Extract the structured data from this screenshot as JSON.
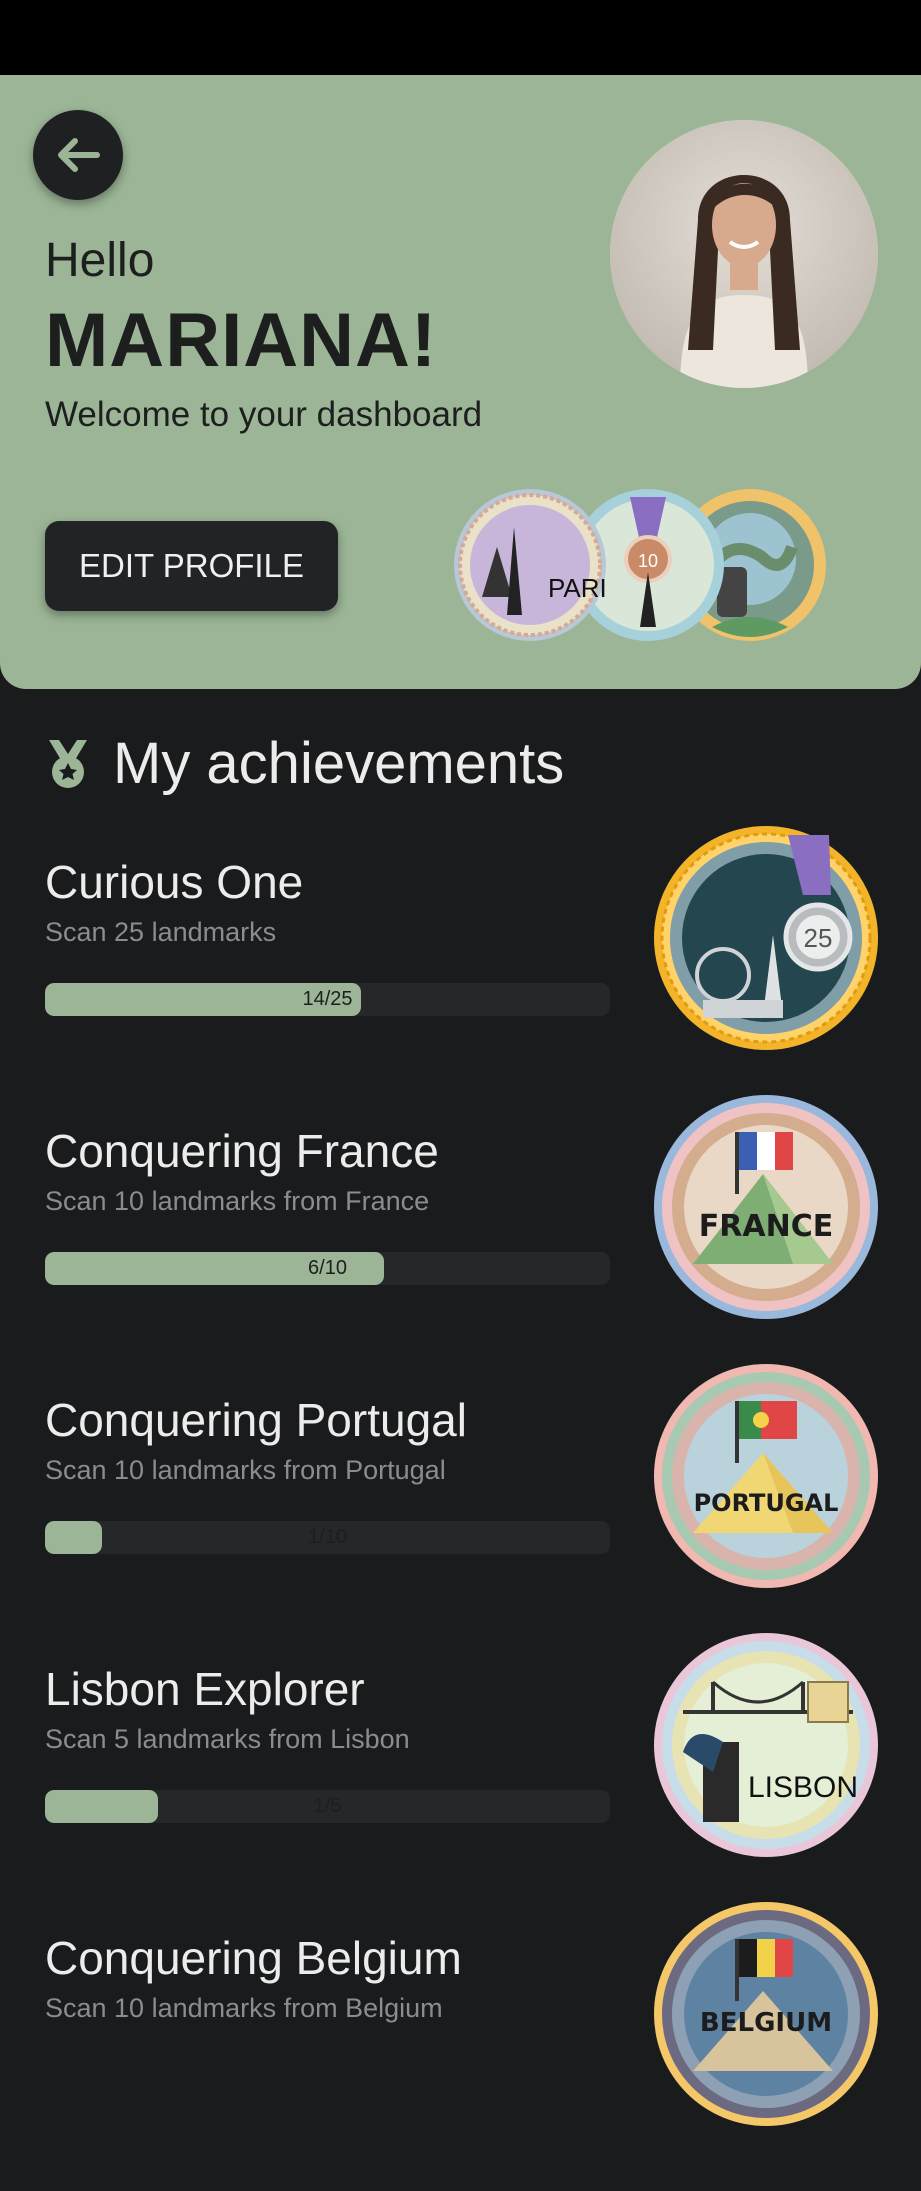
{
  "header": {
    "greeting": "Hello",
    "user_name": "MARIANA!",
    "subtitle": "Welcome to your dashboard",
    "edit_button_label": "EDIT PROFILE",
    "badge_labels": [
      "PARIS",
      "10"
    ]
  },
  "achievements_title": "My achievements",
  "achievements": [
    {
      "name": "Curious One",
      "description": "Scan 25 landmarks",
      "progress_label": "14/25",
      "current": 14,
      "total": 25,
      "badge_text": "25"
    },
    {
      "name": "Conquering France",
      "description": "Scan 10 landmarks from France",
      "progress_label": "6/10",
      "current": 6,
      "total": 10,
      "badge_text": "FRANCE"
    },
    {
      "name": "Conquering Portugal",
      "description": "Scan 10 landmarks from Portugal",
      "progress_label": "1/10",
      "current": 1,
      "total": 10,
      "badge_text": "PORTUGAL"
    },
    {
      "name": "Lisbon Explorer",
      "description": "Scan 5 landmarks from Lisbon",
      "progress_label": "1/5",
      "current": 1,
      "total": 5,
      "badge_text": "LISBON"
    },
    {
      "name": "Conquering Belgium",
      "description": "Scan 10 landmarks from Belgium",
      "progress_label": "",
      "current": 0,
      "total": 10,
      "badge_text": "BELGIUM"
    }
  ],
  "colors": {
    "accent": "#9bb596",
    "background": "#1a1b1d",
    "track": "#262729"
  }
}
